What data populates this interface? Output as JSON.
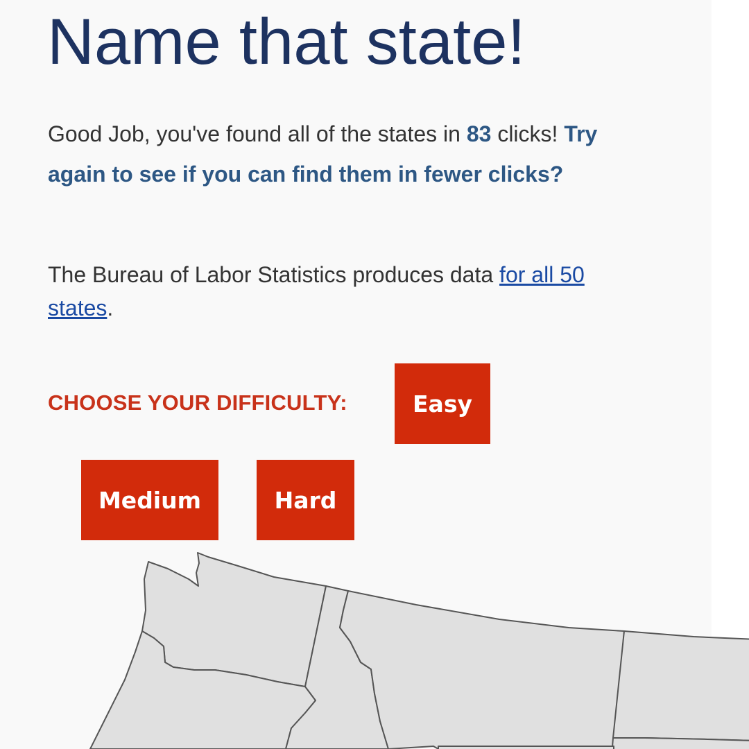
{
  "page": {
    "title": "Name that state!"
  },
  "result": {
    "prefix": "Good Job, you've found all of the states in ",
    "clicks": "83",
    "middle": " clicks! ",
    "try_again": "Try again to see if you can find them in fewer clicks?"
  },
  "bls": {
    "text_before": "The Bureau of Labor Statistics produces data ",
    "link_text": "for all 50 states",
    "text_after": "."
  },
  "difficulty": {
    "label": "CHOOSE YOUR DIFFICULTY:",
    "options": [
      "Easy",
      "Medium",
      "Hard"
    ]
  },
  "map": {
    "states_visible": [
      "Washington",
      "Oregon",
      "Idaho",
      "Montana",
      "North Dakota",
      "South Dakota"
    ],
    "fill_color": "#e0e0e0",
    "border_color": "#555555"
  },
  "colors": {
    "title": "#1d3260",
    "emphasis": "#2d5784",
    "link": "#1a4aa3",
    "accent": "#c8321a",
    "button": "#d22b0b",
    "background": "#f9f9f9"
  }
}
